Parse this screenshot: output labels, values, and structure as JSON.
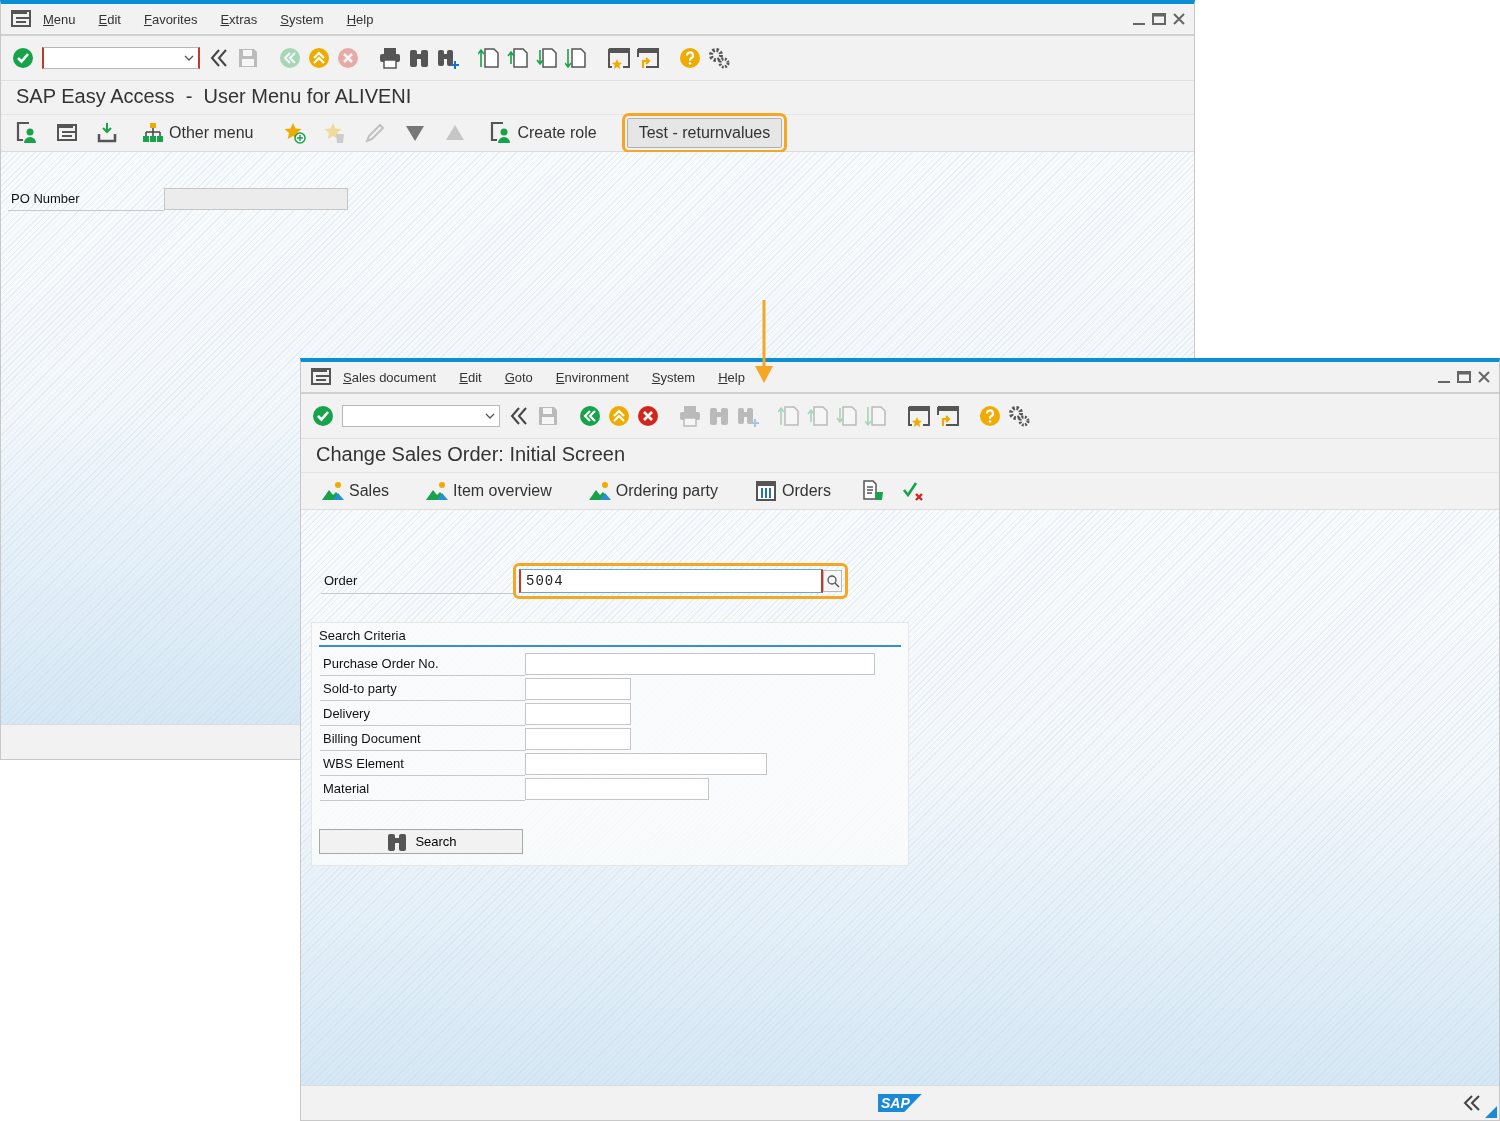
{
  "window_1": {
    "menu": [
      "Menu",
      "Edit",
      "Favorites",
      "Extras",
      "System",
      "Help"
    ],
    "toolbar": [
      {
        "kind": "enter",
        "disabled": false
      },
      {
        "kind": "command-field",
        "focused": true
      },
      {
        "kind": "collapse",
        "disabled": false
      },
      {
        "kind": "save",
        "disabled": true
      },
      {
        "kind": "back",
        "disabled": true
      },
      {
        "kind": "exit",
        "disabled": false
      },
      {
        "kind": "cancel",
        "disabled": true
      },
      {
        "kind": "print",
        "disabled": false
      },
      {
        "kind": "find",
        "disabled": false
      },
      {
        "kind": "find-next",
        "disabled": false
      },
      {
        "kind": "first-page",
        "disabled": false
      },
      {
        "kind": "previous-page",
        "disabled": false
      },
      {
        "kind": "next-page",
        "disabled": false
      },
      {
        "kind": "last-page",
        "disabled": false
      },
      {
        "kind": "new-session",
        "disabled": false
      },
      {
        "kind": "shortcut",
        "disabled": false
      },
      {
        "kind": "help",
        "disabled": false
      },
      {
        "kind": "settings",
        "disabled": false
      }
    ],
    "title": "SAP Easy Access  -  User Menu for ALIVENI",
    "app_toolbar": [
      {
        "kind": "user-window",
        "disabled": false
      },
      {
        "kind": "menu",
        "disabled": false
      },
      {
        "kind": "download",
        "disabled": false
      },
      {
        "kind": "hierarchy",
        "label": "Other menu"
      },
      {
        "kind": "star-add",
        "disabled": false
      },
      {
        "kind": "star-delete",
        "disabled": true
      },
      {
        "kind": "pencil",
        "disabled": true
      },
      {
        "kind": "triangle-down",
        "disabled": false
      },
      {
        "kind": "triangle-up",
        "disabled": true
      },
      {
        "kind": "user-window",
        "label": "Create role"
      },
      {
        "kind": "push-button",
        "label": "Test - returnvalues",
        "highlighted": true
      }
    ],
    "fields": [
      {
        "label": "PO Number",
        "disabled": true
      }
    ]
  },
  "window_2": {
    "menu": [
      "Sales document",
      "Edit",
      "Goto",
      "Environment",
      "System",
      "Help"
    ],
    "toolbar": [
      {
        "kind": "enter",
        "disabled": false
      },
      {
        "kind": "command-field",
        "focused": false
      },
      {
        "kind": "collapse",
        "disabled": false
      },
      {
        "kind": "save",
        "disabled": true
      },
      {
        "kind": "back",
        "disabled": false
      },
      {
        "kind": "exit",
        "disabled": false
      },
      {
        "kind": "cancel",
        "disabled": false
      },
      {
        "kind": "print",
        "disabled": true
      },
      {
        "kind": "find",
        "disabled": true
      },
      {
        "kind": "find-next",
        "disabled": true
      },
      {
        "kind": "first-page",
        "disabled": true
      },
      {
        "kind": "previous-page",
        "disabled": true
      },
      {
        "kind": "next-page",
        "disabled": true
      },
      {
        "kind": "last-page",
        "disabled": true
      },
      {
        "kind": "new-session",
        "disabled": false
      },
      {
        "kind": "shortcut",
        "disabled": false
      },
      {
        "kind": "help",
        "disabled": false
      },
      {
        "kind": "settings",
        "disabled": false
      }
    ],
    "title": "Change Sales Order: Initial Screen",
    "app_toolbar": [
      {
        "kind": "mountain",
        "label": "Sales"
      },
      {
        "kind": "mountain",
        "label": "Item overview"
      },
      {
        "kind": "mountain",
        "label": "Ordering party"
      },
      {
        "kind": "table",
        "label": "Orders"
      },
      {
        "kind": "document",
        "disabled": false
      },
      {
        "kind": "check-cross",
        "disabled": false
      }
    ],
    "order_field": {
      "label": "Order",
      "value": "5004",
      "focused": true,
      "highlighted": true
    },
    "group": {
      "title": "Search Criteria",
      "fields": [
        {
          "label": "Purchase Order No."
        },
        {
          "label": "Sold-to party"
        },
        {
          "label": "Delivery"
        },
        {
          "label": "Billing Document"
        },
        {
          "label": "WBS Element"
        },
        {
          "label": "Material"
        }
      ],
      "button": "Search"
    },
    "status_bar": {
      "logo": "SAP"
    }
  }
}
